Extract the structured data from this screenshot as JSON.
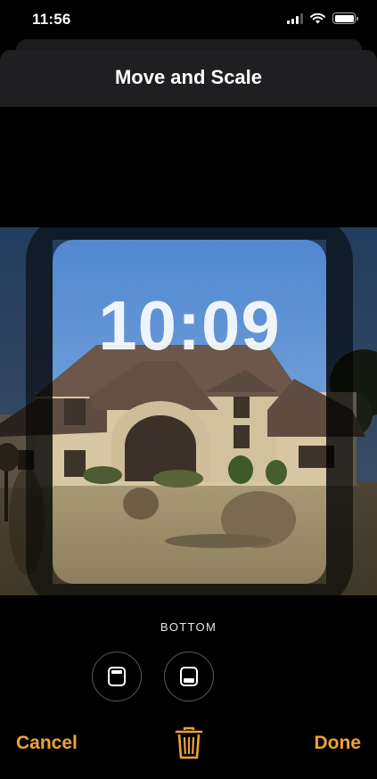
{
  "status_bar": {
    "time": "11:56",
    "icons": [
      "cellular-signal-icon",
      "wifi-icon",
      "battery-icon"
    ]
  },
  "header": {
    "title": "Move and Scale"
  },
  "preview": {
    "clock": "10:09",
    "photo_subject": "house-photo"
  },
  "clock_position": {
    "label": "BOTTOM",
    "options": [
      "clock-top-icon",
      "clock-bottom-icon"
    ],
    "selected": "BOTTOM"
  },
  "actions": {
    "cancel_label": "Cancel",
    "done_label": "Done",
    "delete_icon": "trash-icon"
  },
  "colors": {
    "accent": "#f0a233",
    "background": "#000000",
    "sheet": "#1f1f21"
  }
}
